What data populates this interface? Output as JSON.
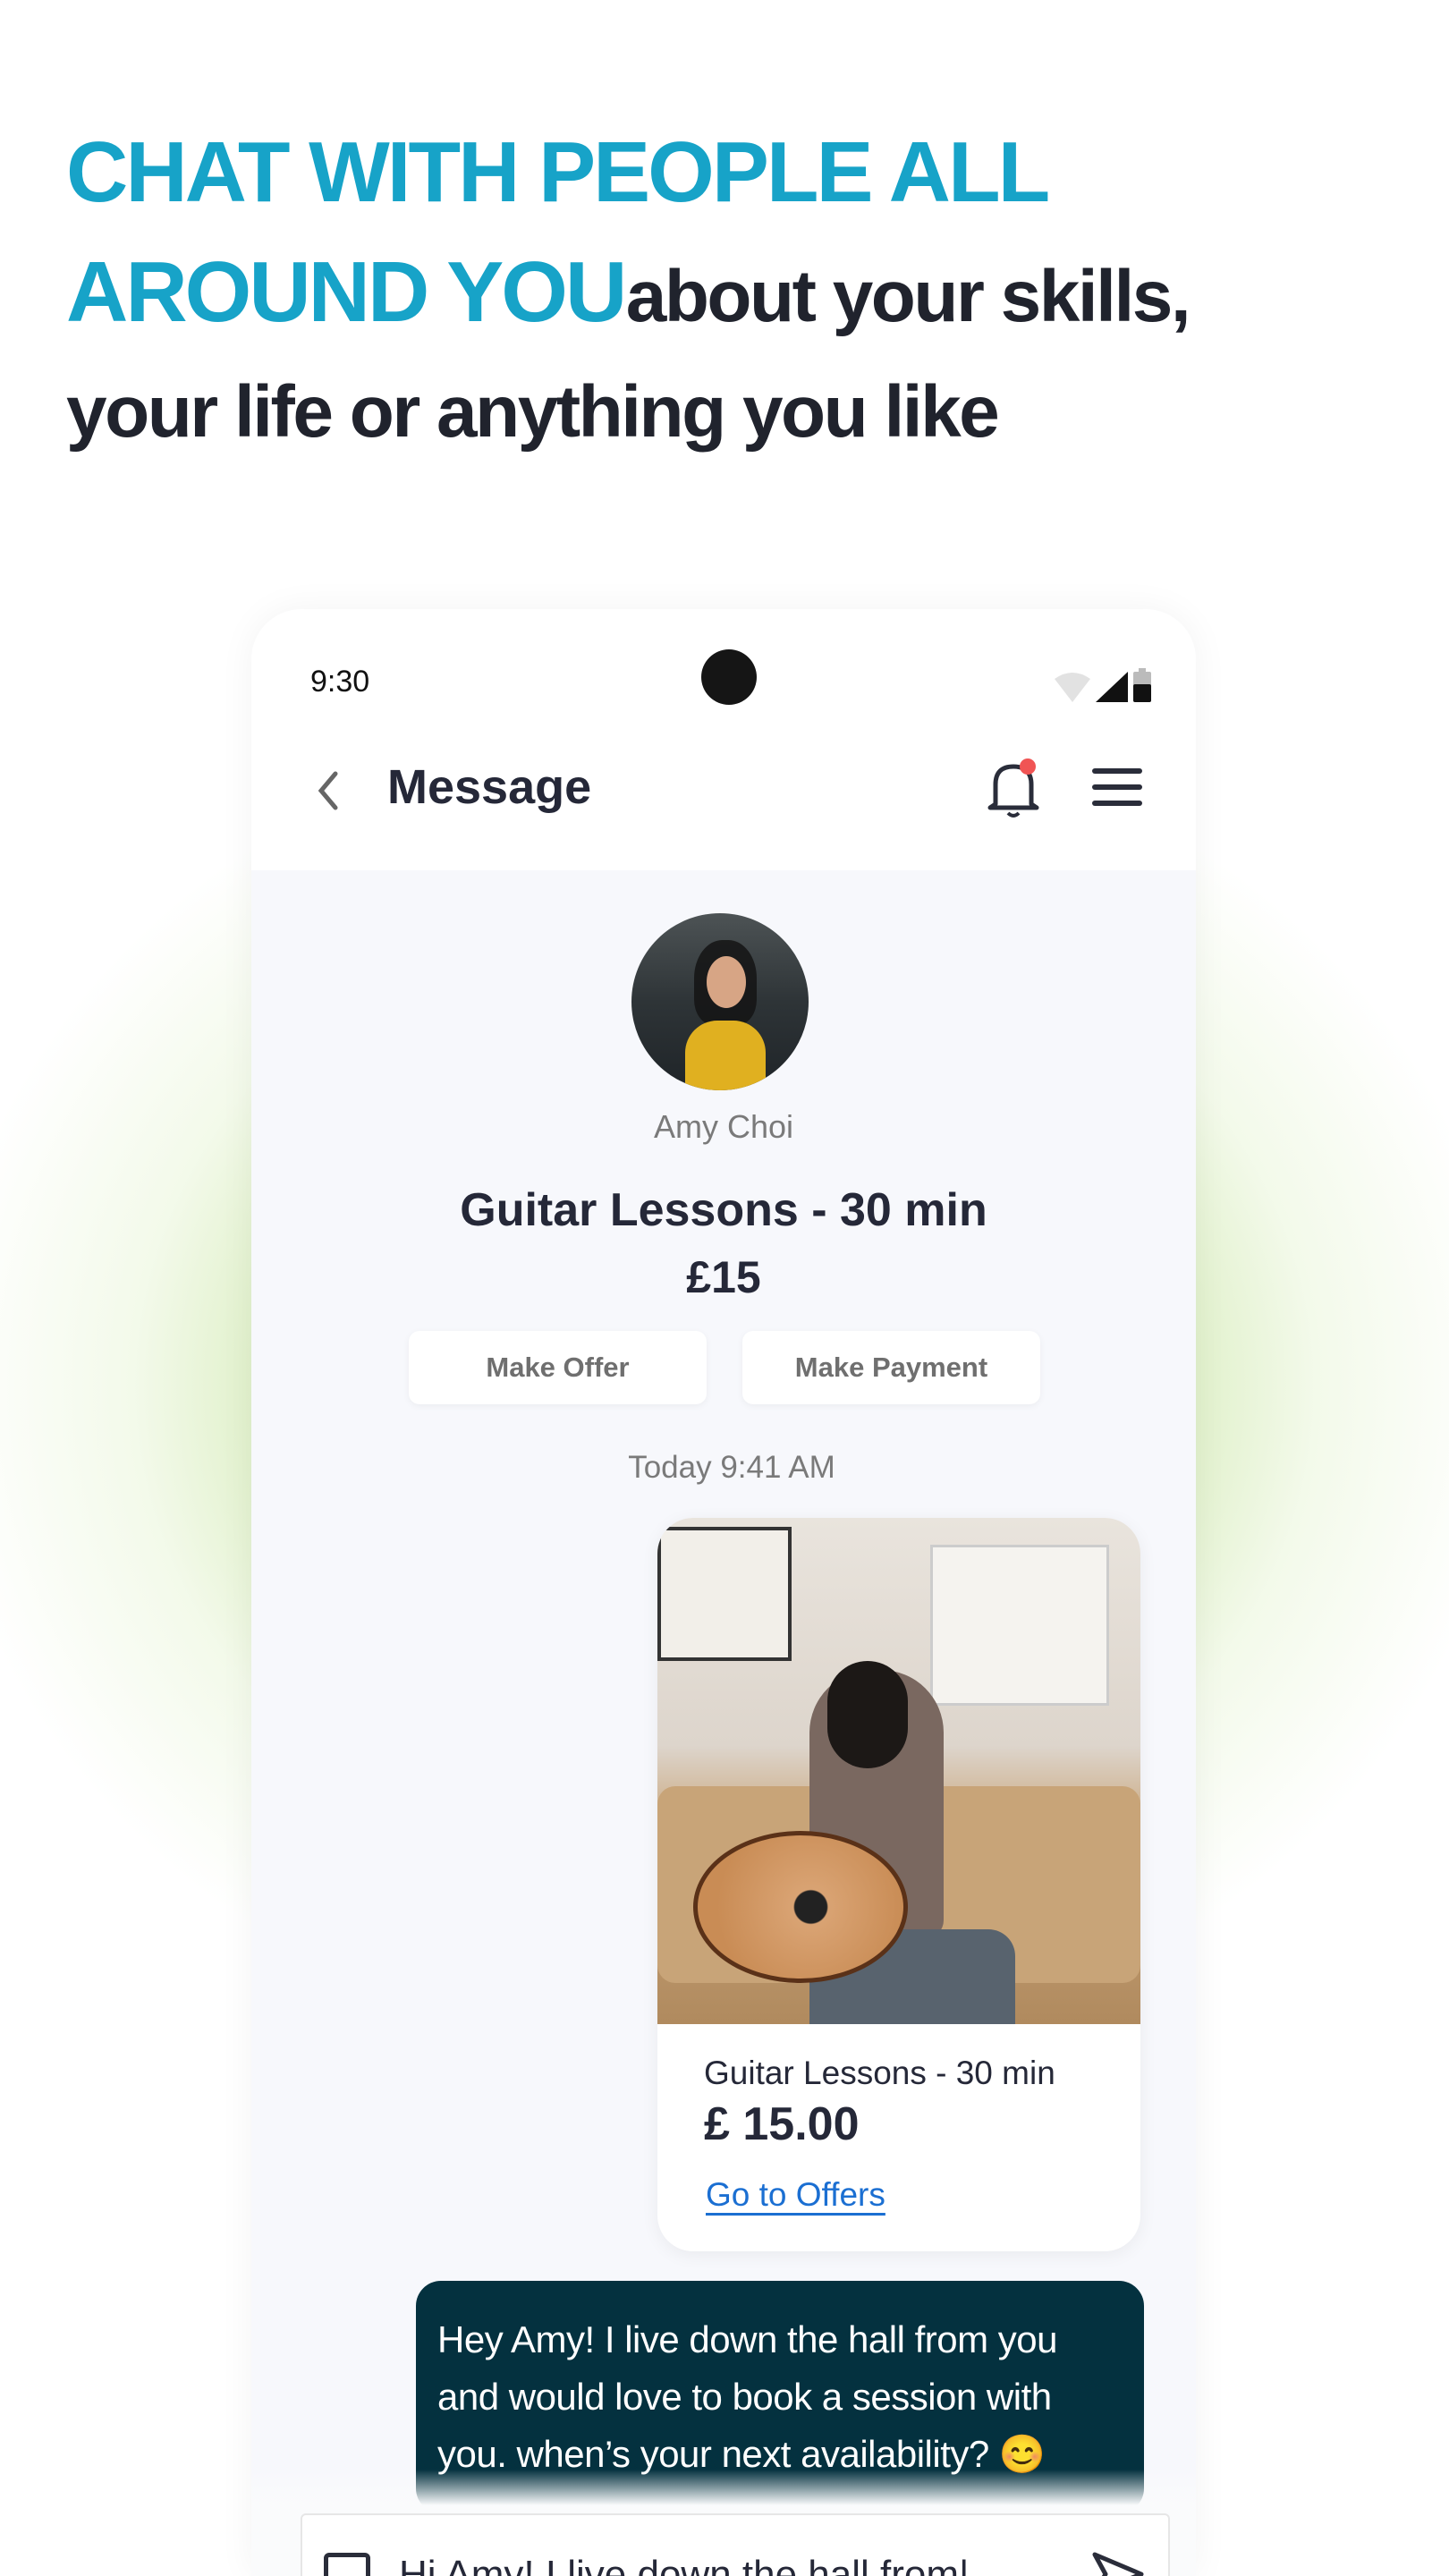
{
  "headline": {
    "highlight_line1": "CHAT WITH PEOPLE ALL",
    "highlight_line2": "AROUND YOU",
    "rest_line2": "about your skills,",
    "rest_line3": "your life or anything you like"
  },
  "colors": {
    "accent": "#17a3c8",
    "bubble": "#04313f",
    "link": "#1b6fd2",
    "notification_dot": "#f05454"
  },
  "status_bar": {
    "time": "9:30",
    "icons": [
      "wifi-icon",
      "signal-icon",
      "battery-icon"
    ]
  },
  "header": {
    "title": "Message",
    "back_icon": "chevron-left-icon",
    "bell_icon": "bell-icon",
    "menu_icon": "hamburger-icon"
  },
  "profile": {
    "name": "Amy Choi"
  },
  "listing": {
    "title": "Guitar Lessons - 30 min",
    "price": "£15"
  },
  "actions": {
    "make_offer": "Make Offer",
    "make_payment": "Make Payment"
  },
  "chat": {
    "timestamp": "Today 9:41 AM",
    "offer_card": {
      "title": "Guitar Lessons - 30 min",
      "price": "£ 15.00",
      "link": "Go to Offers"
    },
    "message": "Hey Amy! I live down the hall from you and would love to book a session with you. when’s  your next availability? 😊"
  },
  "composer": {
    "value": "Hi Amy! I live down the hall from|"
  }
}
